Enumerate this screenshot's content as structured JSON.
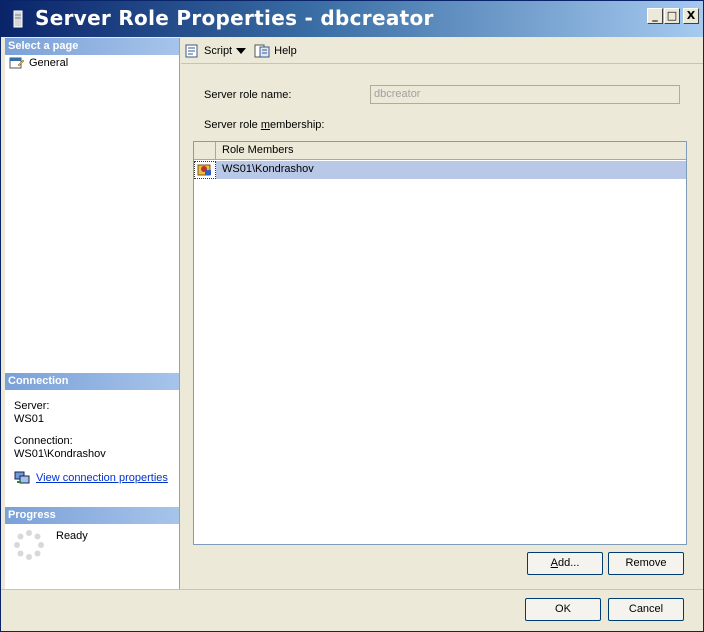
{
  "window": {
    "title": "Server Role Properties - dbcreator",
    "minimize": "_",
    "maximize": "□",
    "close": "X"
  },
  "left": {
    "select_page_header": "Select a page",
    "pages": [
      {
        "label": "General",
        "icon": "page-properties-icon"
      }
    ],
    "connection_header": "Connection",
    "server_label": "Server:",
    "server_value": "WS01",
    "connection_label": "Connection:",
    "connection_value": "WS01\\Kondrashov",
    "view_link": "View connection properties",
    "progress_header": "Progress",
    "progress_status": "Ready"
  },
  "toolbar": {
    "script_label": "Script",
    "help_label": "Help"
  },
  "form": {
    "role_name_label": "Server role name:",
    "role_name_value": "dbcreator",
    "membership_label_pre": "Server role ",
    "membership_label_u": "m",
    "membership_label_post": "embership:",
    "grid_header": "Role Members",
    "members": [
      "WS01\\Kondrashov"
    ]
  },
  "buttons": {
    "add_u": "A",
    "add_rest": "dd...",
    "remove": "Remove",
    "ok": "OK",
    "cancel": "Cancel"
  },
  "colors": {
    "title_start": "#0a246a",
    "title_end": "#a6caf0",
    "selected_row": "#b9c8e6",
    "link": "#0033cc"
  }
}
